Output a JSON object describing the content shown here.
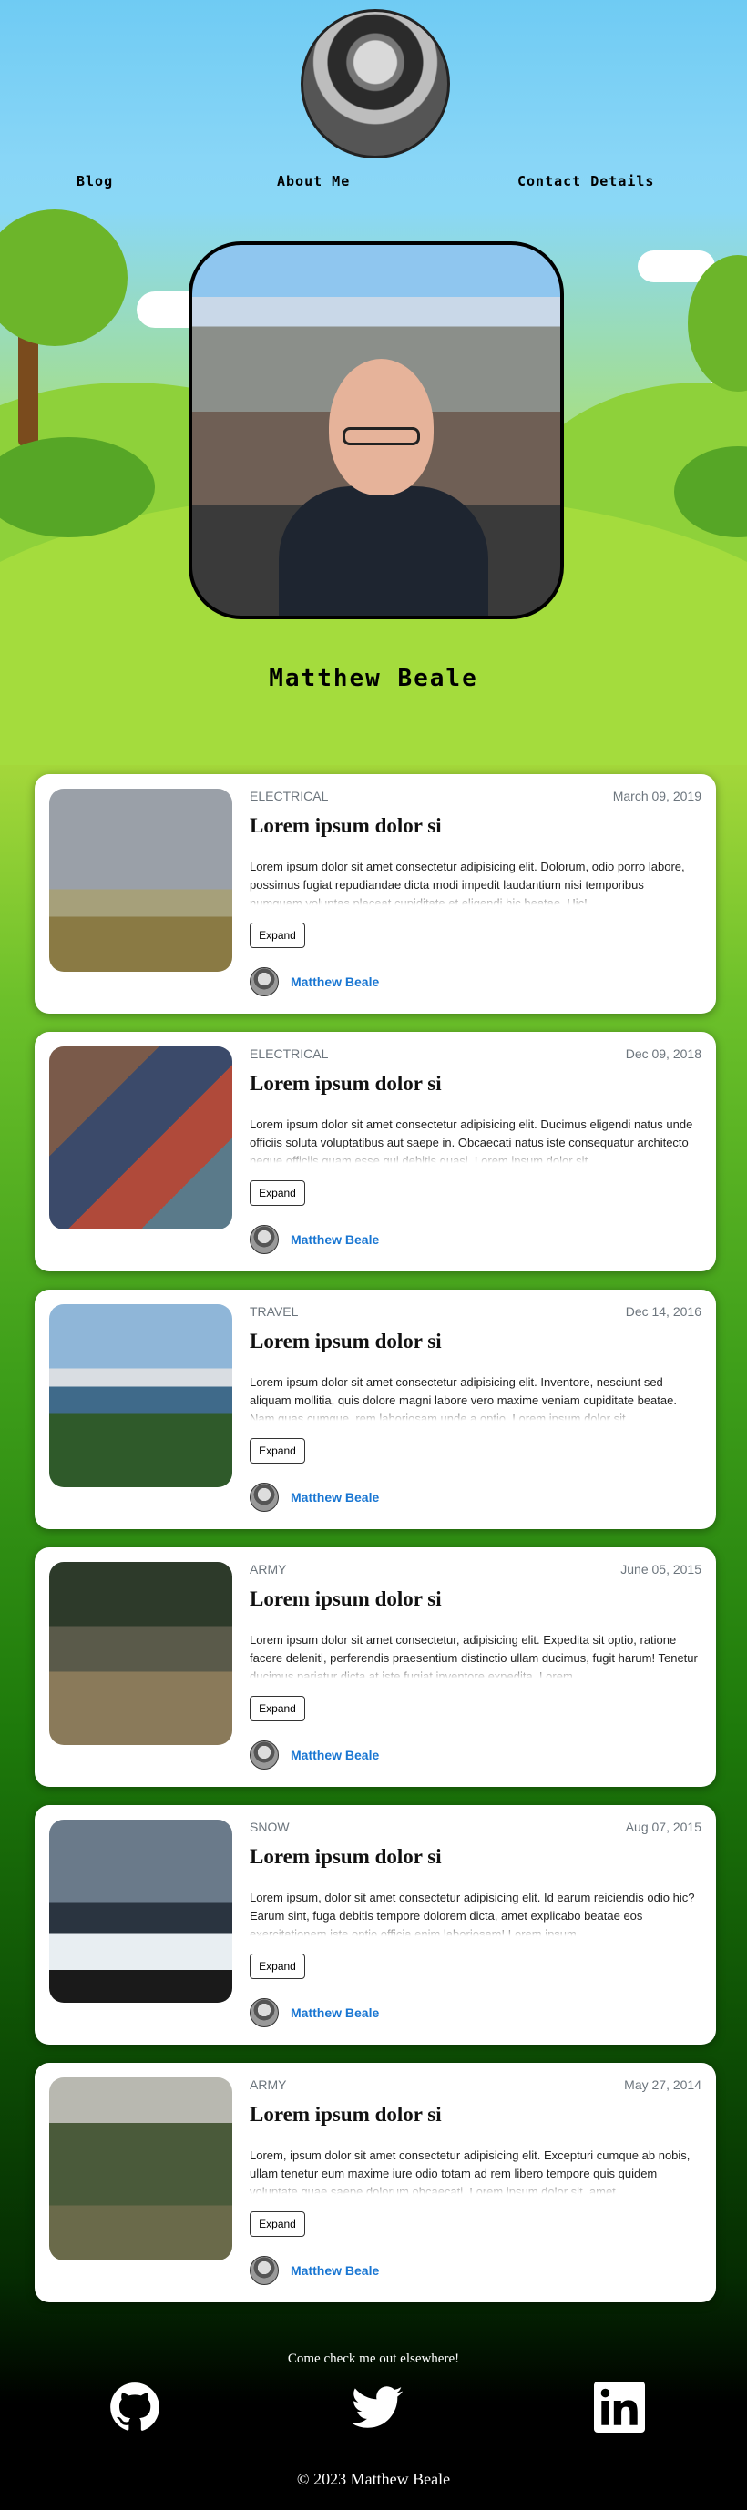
{
  "nav": {
    "links": [
      "Blog",
      "About Me",
      "Contact Details"
    ]
  },
  "profile": {
    "name": "Matthew Beale"
  },
  "posts": [
    {
      "category": "ELECTRICAL",
      "date": "March 09, 2019",
      "title": "Lorem ipsum dolor si",
      "excerpt": "Lorem ipsum dolor sit amet consectetur adipisicing elit. Dolorum, odio porro labore, possimus fugiat repudiandae dicta modi impedit laudantium nisi temporibus numquam voluptas placeat cupiditate et eligendi hic beatae. Hic!",
      "expand": "Expand",
      "author": "Matthew Beale"
    },
    {
      "category": "ELECTRICAL",
      "date": "Dec 09, 2018",
      "title": "Lorem ipsum dolor si",
      "excerpt": "Lorem ipsum dolor sit amet consectetur adipisicing elit. Ducimus eligendi natus unde officiis soluta voluptatibus aut saepe in. Obcaecati natus iste consequatur architecto neque officiis quam esse qui debitis quasi. Lorem ipsum dolor sit",
      "expand": "Expand",
      "author": "Matthew Beale"
    },
    {
      "category": "TRAVEL",
      "date": "Dec 14, 2016",
      "title": "Lorem ipsum dolor si",
      "excerpt": "Lorem ipsum dolor sit amet consectetur adipisicing elit. Inventore, nesciunt sed aliquam mollitia, quis dolore magni labore vero maxime veniam cupiditate beatae. Nam quas cumque, rem laboriosam unde a optio. Lorem ipsum dolor sit",
      "expand": "Expand",
      "author": "Matthew Beale"
    },
    {
      "category": "ARMY",
      "date": "June 05, 2015",
      "title": "Lorem ipsum dolor si",
      "excerpt": "Lorem ipsum dolor sit amet consectetur, adipisicing elit. Expedita sit optio, ratione facere deleniti, perferendis praesentium distinctio ullam ducimus, fugit harum! Tenetur ducimus pariatur dicta at iste fugiat inventore expedita. Lorem",
      "expand": "Expand",
      "author": "Matthew Beale"
    },
    {
      "category": "SNOW",
      "date": "Aug 07, 2015",
      "title": "Lorem ipsum dolor si",
      "excerpt": "Lorem ipsum, dolor sit amet consectetur adipisicing elit. Id earum reiciendis odio hic? Earum sint, fuga debitis tempore dolorem dicta, amet explicabo beatae eos exercitationem iste optio officia enim laboriosam! Lorem ipsum",
      "expand": "Expand",
      "author": "Matthew Beale"
    },
    {
      "category": "ARMY",
      "date": "May 27, 2014",
      "title": "Lorem ipsum dolor si",
      "excerpt": "Lorem, ipsum dolor sit amet consectetur adipisicing elit. Excepturi cumque ab nobis, ullam tenetur eum maxime iure odio totam ad rem libero tempore quis quidem voluptate quae saepe dolorum obcaecati. Lorem ipsum dolor sit, amet",
      "expand": "Expand",
      "author": "Matthew Beale"
    }
  ],
  "footer": {
    "tagline": "Come check me out elsewhere!",
    "social_icons": [
      "github-icon",
      "twitter-icon",
      "linkedin-icon"
    ],
    "copyright": "© 2023 Matthew Beale"
  }
}
